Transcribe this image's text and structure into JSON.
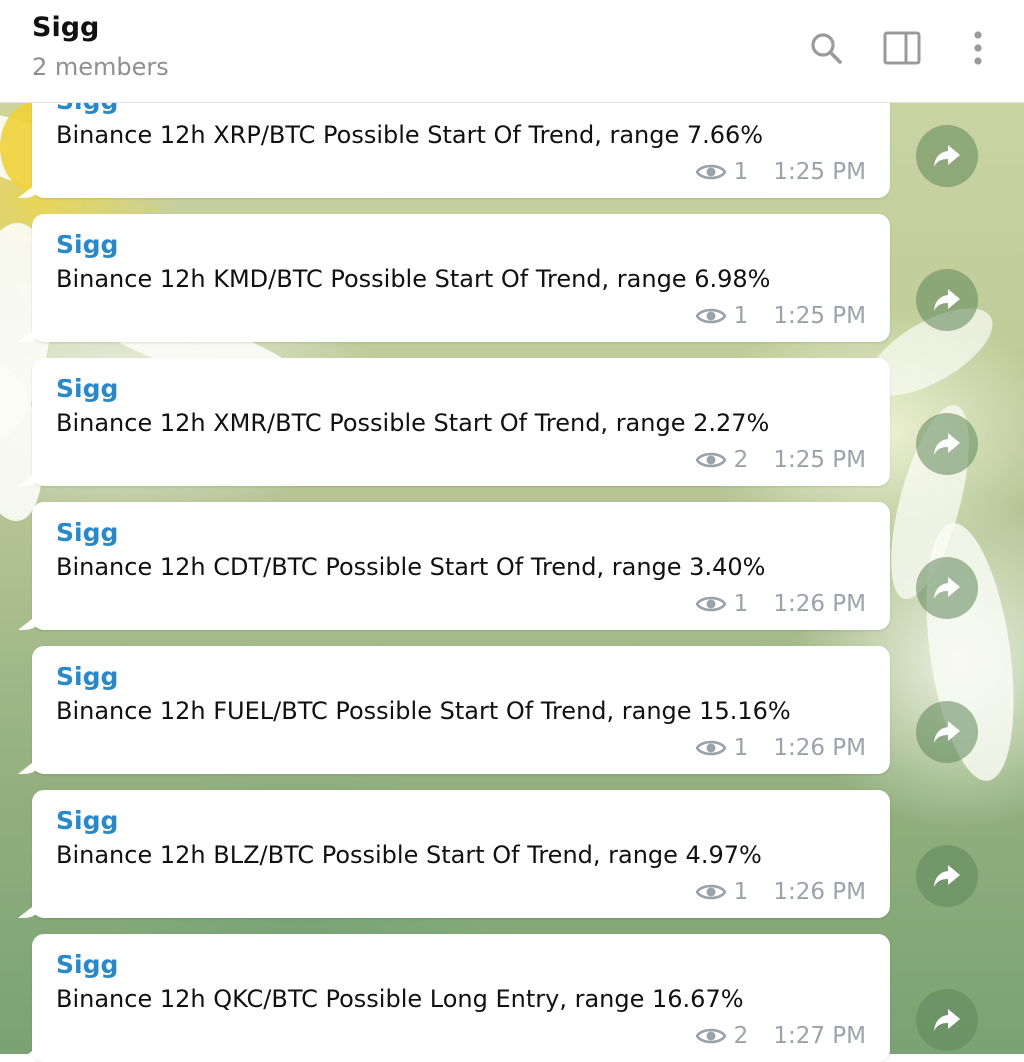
{
  "header": {
    "title": "Sigg",
    "subtitle": "2 members",
    "icons": [
      "search-icon",
      "sidebar-toggle-icon",
      "more-vertical-icon"
    ]
  },
  "colors": {
    "sender": "#2a88c8",
    "meta": "#9aa3ab",
    "bubble": "#ffffff"
  },
  "messages": [
    {
      "sender": "Sigg",
      "text": "Binance 12h XRP/BTC Possible Start Of Trend, range 7.66%",
      "views": "1",
      "time": "1:25 PM"
    },
    {
      "sender": "Sigg",
      "text": "Binance 12h KMD/BTC Possible Start Of Trend, range 6.98%",
      "views": "1",
      "time": "1:25 PM"
    },
    {
      "sender": "Sigg",
      "text": "Binance 12h XMR/BTC Possible Start Of Trend, range 2.27%",
      "views": "2",
      "time": "1:25 PM"
    },
    {
      "sender": "Sigg",
      "text": "Binance 12h CDT/BTC Possible Start Of Trend, range 3.40%",
      "views": "1",
      "time": "1:26 PM"
    },
    {
      "sender": "Sigg",
      "text": "Binance 12h FUEL/BTC Possible Start Of Trend, range 15.16%",
      "views": "1",
      "time": "1:26 PM"
    },
    {
      "sender": "Sigg",
      "text": "Binance 12h BLZ/BTC Possible Start Of Trend, range 4.97%",
      "views": "1",
      "time": "1:26 PM"
    },
    {
      "sender": "Sigg",
      "text": "Binance 12h QKC/BTC Possible Long Entry, range 16.67%",
      "views": "2",
      "time": "1:27 PM"
    }
  ]
}
